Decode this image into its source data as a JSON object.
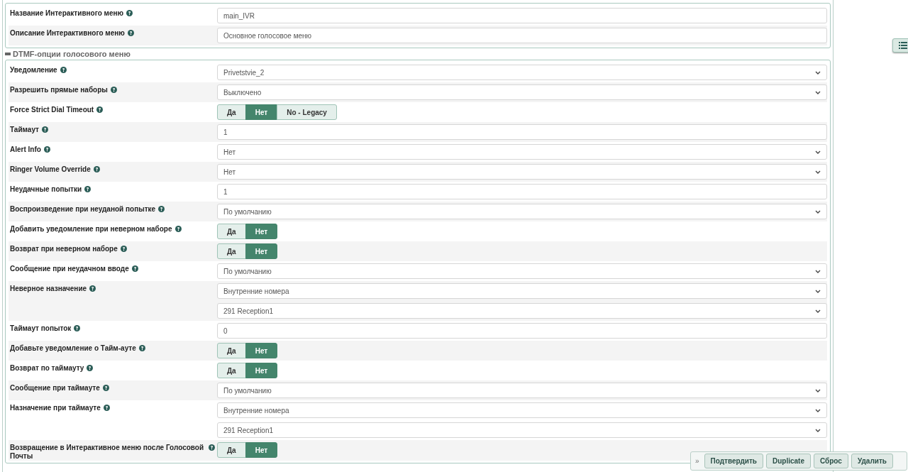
{
  "sections": [
    {
      "rows": [
        {
          "label": "Название Интерактивного меню",
          "kind": "text",
          "value": "main_IVR"
        },
        {
          "label": "Описание Интерактивного меню",
          "kind": "text",
          "value": "Основное голосовое меню"
        }
      ]
    },
    {
      "legend": "DTMF-опции голосового меню",
      "rows": [
        {
          "label": "Уведомление",
          "kind": "select",
          "values": [
            "Privetstvie_2"
          ]
        },
        {
          "label": "Разрешить прямые наборы",
          "kind": "select",
          "values": [
            "Выключено"
          ]
        },
        {
          "label": "Force Strict Dial Timeout",
          "kind": "toggle",
          "options": [
            {
              "label": "Да",
              "selected": false
            },
            {
              "label": "Нет",
              "selected": true
            },
            {
              "label": "No - Legacy",
              "selected": false
            }
          ]
        },
        {
          "label": "Таймаут",
          "kind": "text",
          "value": "1"
        },
        {
          "label": "Alert Info",
          "kind": "select",
          "values": [
            "Нет"
          ]
        },
        {
          "label": "Ringer Volume Override",
          "kind": "select",
          "values": [
            "Нет"
          ]
        },
        {
          "label": "Неудачные попытки",
          "kind": "text",
          "value": "1"
        },
        {
          "label": "Воспроизведение при неуданой попытке",
          "kind": "select",
          "values": [
            "По умолчанию"
          ]
        },
        {
          "label": "Добавить уведомление при неверном наборе",
          "kind": "toggle",
          "options": [
            {
              "label": "Да",
              "selected": false
            },
            {
              "label": "Нет",
              "selected": true
            }
          ]
        },
        {
          "label": "Возврат при неверном наборе",
          "kind": "toggle",
          "options": [
            {
              "label": "Да",
              "selected": false
            },
            {
              "label": "Нет",
              "selected": true
            }
          ]
        },
        {
          "label": "Сообщение при неудачном вводе",
          "kind": "select",
          "values": [
            "По умолчанию"
          ]
        },
        {
          "label": "Неверное назначение",
          "kind": "select",
          "values": [
            "Внутренние номера",
            "291 Reception1"
          ]
        },
        {
          "label": "Таймаут попыток",
          "kind": "text",
          "value": "0"
        },
        {
          "label": "Добавьте уведомление о Тайм-ауте",
          "kind": "toggle",
          "options": [
            {
              "label": "Да",
              "selected": false
            },
            {
              "label": "Нет",
              "selected": true
            }
          ]
        },
        {
          "label": "Возврат по таймауту",
          "kind": "toggle",
          "options": [
            {
              "label": "Да",
              "selected": false
            },
            {
              "label": "Нет",
              "selected": true
            }
          ]
        },
        {
          "label": "Сообщение при таймауте",
          "kind": "select",
          "values": [
            "По умолчанию"
          ]
        },
        {
          "label": "Назначение при таймауте",
          "kind": "select",
          "values": [
            "Внутренние номера",
            "291 Reception1"
          ]
        },
        {
          "label": "Возвращение в Интерактивное меню после Голосовой Почты",
          "kind": "toggle",
          "options": [
            {
              "label": "Да",
              "selected": false
            },
            {
              "label": "Нет",
              "selected": true
            }
          ]
        }
      ]
    }
  ],
  "action_bar": {
    "expand": "»",
    "buttons": [
      "Подтвердить",
      "Duplicate",
      "Сброс",
      "Удалить"
    ]
  }
}
